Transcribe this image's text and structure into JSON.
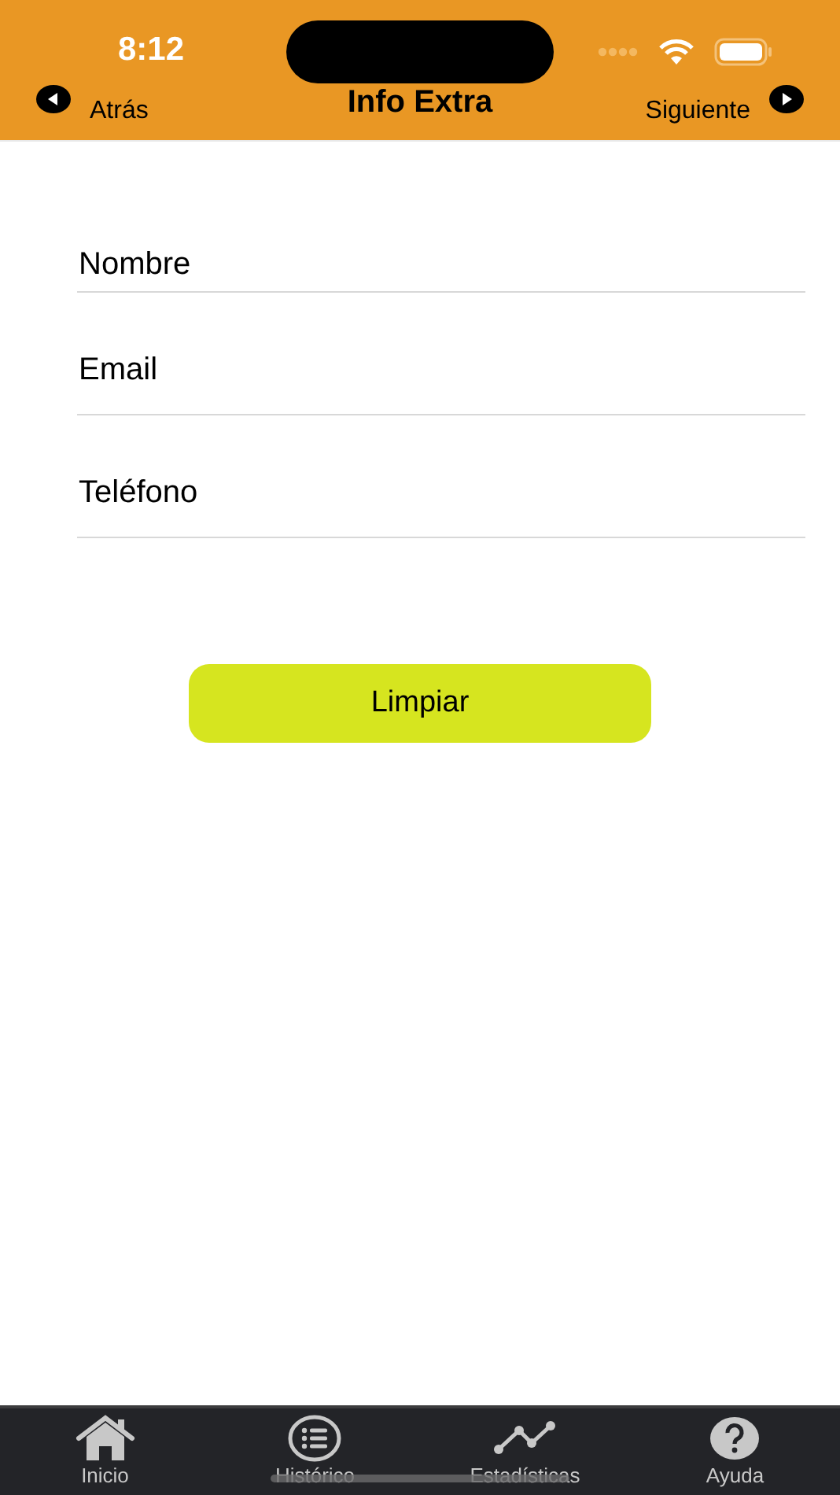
{
  "status_bar": {
    "time": "8:12"
  },
  "nav": {
    "back": "Atrás",
    "title": "Info Extra",
    "next": "Siguiente"
  },
  "fields": [
    {
      "placeholder": "Nombre"
    },
    {
      "placeholder": "Email"
    },
    {
      "placeholder": "Teléfono"
    }
  ],
  "button": "Limpiar",
  "tab_bar": [
    {
      "kind": "home",
      "label": "Inicio"
    },
    {
      "kind": "list",
      "label": "Histórico"
    },
    {
      "kind": "chart",
      "label": "Estadísticas"
    },
    {
      "kind": "help",
      "label": "Ayuda"
    }
  ]
}
